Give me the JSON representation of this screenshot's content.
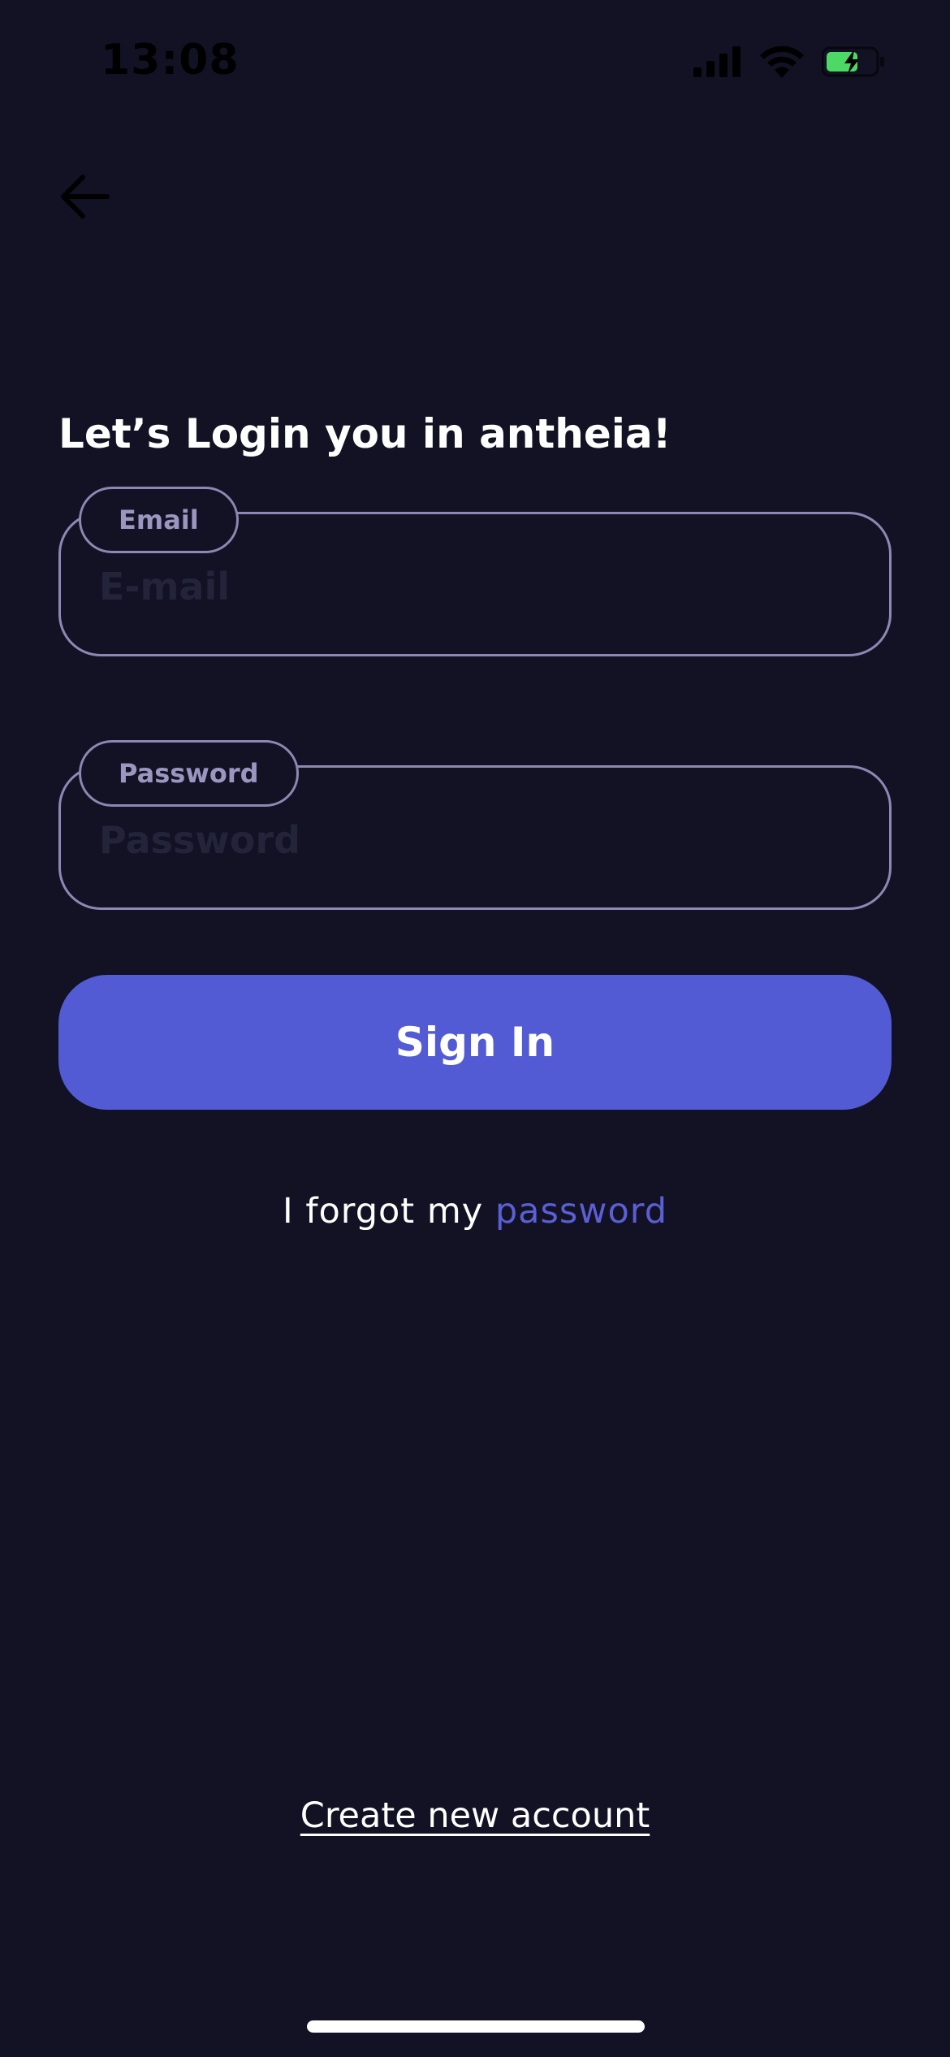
{
  "status_bar": {
    "time": "13:08",
    "icons": [
      "cellular-signal-icon",
      "wifi-icon",
      "battery-charging-icon"
    ],
    "battery_color": "#4cd964"
  },
  "nav": {
    "back_icon": "arrow-left-icon"
  },
  "heading": "Let’s Login you in antheia!",
  "form": {
    "email": {
      "label": "Email",
      "placeholder": "E-mail",
      "value": ""
    },
    "password": {
      "label": "Password",
      "placeholder": "Password",
      "value": ""
    },
    "submit_label": "Sign In"
  },
  "forgot": {
    "prefix": "I forgot my ",
    "link": "password"
  },
  "create_account": "Create new account",
  "colors": {
    "background": "#121224",
    "accent": "#525bd4",
    "link": "#5a5fd6",
    "field_border": "#8c88b4"
  }
}
